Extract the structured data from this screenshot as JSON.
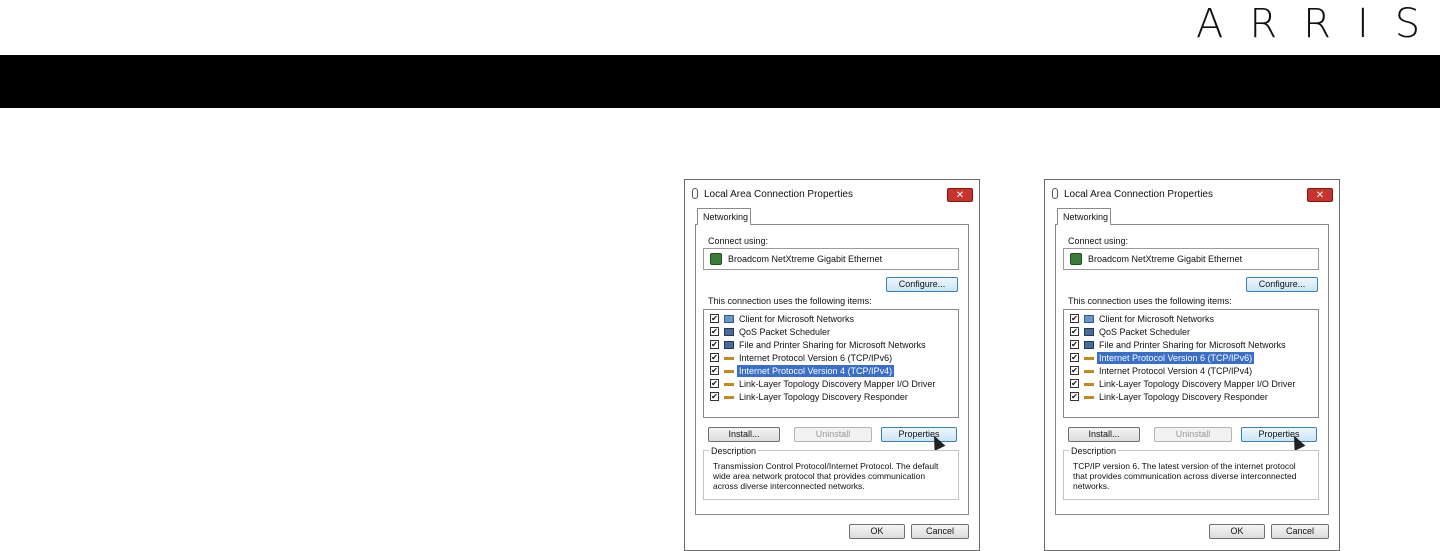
{
  "brand": {
    "logo": "ARRIS"
  },
  "dialogs": [
    {
      "title": "Local Area Connection Properties",
      "close": "✕",
      "tab": "Networking",
      "connect_using_label": "Connect using:",
      "adapter": "Broadcom NetXtreme Gigabit Ethernet",
      "configure_button": "Configure...",
      "items_label": "This connection uses the following items:",
      "items": [
        {
          "label": "Client for Microsoft Networks",
          "checked": true,
          "icon": "network-client-icon"
        },
        {
          "label": "QoS Packet Scheduler",
          "checked": true,
          "icon": "scheduler-icon"
        },
        {
          "label": "File and Printer Sharing for Microsoft Networks",
          "checked": true,
          "icon": "sharing-icon"
        },
        {
          "label": "Internet Protocol Version 6 (TCP/IPv6)",
          "checked": true,
          "icon": "protocol-icon"
        },
        {
          "label": "Internet Protocol Version 4 (TCP/IPv4)",
          "checked": true,
          "icon": "protocol-icon",
          "selected": true
        },
        {
          "label": "Link-Layer Topology Discovery Mapper I/O Driver",
          "checked": true,
          "icon": "protocol-icon"
        },
        {
          "label": "Link-Layer Topology Discovery Responder",
          "checked": true,
          "icon": "protocol-icon"
        }
      ],
      "install_button": "Install...",
      "uninstall_button": "Uninstall",
      "properties_button": "Properties",
      "description_label": "Description",
      "description": "Transmission Control Protocol/Internet Protocol. The default wide area network protocol that provides communication across diverse interconnected networks.",
      "ok_button": "OK",
      "cancel_button": "Cancel"
    },
    {
      "title": "Local Area Connection Properties",
      "close": "✕",
      "tab": "Networking",
      "connect_using_label": "Connect using:",
      "adapter": "Broadcom NetXtreme Gigabit Ethernet",
      "configure_button": "Configure...",
      "items_label": "This connection uses the following items:",
      "items": [
        {
          "label": "Client for Microsoft Networks",
          "checked": true,
          "icon": "network-client-icon"
        },
        {
          "label": "QoS Packet Scheduler",
          "checked": true,
          "icon": "scheduler-icon"
        },
        {
          "label": "File and Printer Sharing for Microsoft Networks",
          "checked": true,
          "icon": "sharing-icon"
        },
        {
          "label": "Internet Protocol Version 6 (TCP/IPv6)",
          "checked": true,
          "icon": "protocol-icon",
          "selected": true
        },
        {
          "label": "Internet Protocol Version 4 (TCP/IPv4)",
          "checked": true,
          "icon": "protocol-icon"
        },
        {
          "label": "Link-Layer Topology Discovery Mapper I/O Driver",
          "checked": true,
          "icon": "protocol-icon"
        },
        {
          "label": "Link-Layer Topology Discovery Responder",
          "checked": true,
          "icon": "protocol-icon"
        }
      ],
      "install_button": "Install...",
      "uninstall_button": "Uninstall",
      "properties_button": "Properties",
      "description_label": "Description",
      "description": "TCP/IP version 6. The latest version of the internet protocol that provides communication across diverse interconnected networks.",
      "ok_button": "OK",
      "cancel_button": "Cancel"
    }
  ],
  "colors": {
    "band": "#000000",
    "selection": "#3a6fc7",
    "close_button": "#c8342b"
  }
}
